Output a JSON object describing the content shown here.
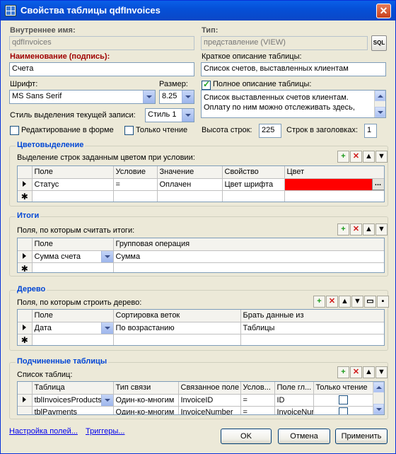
{
  "window": {
    "title": "Свойства таблицы qdfInvoices",
    "close_label": "✕"
  },
  "general": {
    "internal_name_label": "Внутреннее имя:",
    "internal_name_value": "qdfInvoices",
    "type_label": "Тип:",
    "type_value": "представление (VIEW)",
    "sql_button": "SQL",
    "caption_label": "Наименование (подпись):",
    "caption_value": "Счета",
    "short_desc_label": "Краткое описание таблицы:",
    "short_desc_value": "Список счетов, выставленных клиентам",
    "font_label": "Шрифт:",
    "font_value": "MS Sans Serif",
    "size_label": "Размер:",
    "size_value": "8.25",
    "full_desc_label": "Полное описание таблицы:",
    "full_desc_value": "Список выставленных счетов клиентам. Оплату по ним можно отслеживать здесь,",
    "highlight_label": "Стиль выделения текущей записи:",
    "highlight_value": "Стиль 1",
    "edit_in_form_label": "Редактирование в форме",
    "read_only_label": "Только чтение",
    "row_height_label": "Высота строк:",
    "row_height_value": "225",
    "header_rows_label": "Строк в заголовках:",
    "header_rows_value": "1"
  },
  "color_group": {
    "title": "Цветовыделение",
    "subtitle": "Выделение строк заданным цветом при условии:",
    "columns": [
      "Поле",
      "Условие",
      "Значение",
      "Свойство",
      "Цвет"
    ],
    "rows": [
      {
        "field": "Статус",
        "cond": "=",
        "value": "Оплачен",
        "prop": "Цвет шрифта",
        "color": "#ff0000"
      }
    ],
    "ellipsis": "..."
  },
  "totals_group": {
    "title": "Итоги",
    "subtitle": "Поля, по которым считать итоги:",
    "columns": [
      "Поле",
      "Групповая операция"
    ],
    "rows": [
      {
        "field": "Сумма счета",
        "op": "Сумма"
      }
    ]
  },
  "tree_group": {
    "title": "Дерево",
    "subtitle": "Поля, по которым строить дерево:",
    "columns": [
      "Поле",
      "Сортировка веток",
      "Брать данные из"
    ],
    "rows": [
      {
        "field": "Дата",
        "sort": "По возрастанию",
        "source": "Таблицы"
      }
    ]
  },
  "sub_group": {
    "title": "Подчиненные таблицы",
    "subtitle": "Список таблиц:",
    "columns": [
      "Таблица",
      "Тип связи",
      "Связанное поле",
      "Услов...",
      "Поле гл...",
      "Только чтение"
    ],
    "rows": [
      {
        "table": "tblInvoicesProducts",
        "link": "Один-ко-многим",
        "field": "InvoiceID",
        "cond": "=",
        "master": "ID"
      },
      {
        "table": "tblPayments",
        "link": "Один-ко-многим",
        "field": "InvoiceNumber",
        "cond": "=",
        "master": "InvoiceNur"
      }
    ]
  },
  "footer": {
    "fields_link": "Настройка полей...",
    "triggers_link": "Триггеры...",
    "ok": "OK",
    "cancel": "Отмена",
    "apply": "Применить"
  },
  "toolbar": {
    "add": "+",
    "delete": "✕",
    "up": "▲",
    "down": "▼",
    "open": "▭",
    "save": "▪"
  }
}
